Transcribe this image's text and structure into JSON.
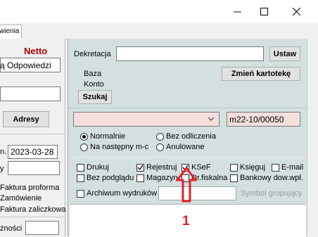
{
  "tab": {
    "label": "wienia"
  },
  "left": {
    "netto": "Netto",
    "odpowiedzi_value": "ą Odpowiedzi",
    "adresy": "Adresy",
    "date_label": "n.",
    "date_value": "2023-03-28",
    "y_label": "y",
    "options": [
      "Faktura proforma",
      "Zamówienie",
      "Faktura zaliczkowa"
    ],
    "znosci": "żności"
  },
  "right": {
    "dekretacja_label": "Dekretacja",
    "ustaw": "Ustaw",
    "baza_label": "Baza",
    "konto_label": "Konto",
    "zmien": "Zmień kartotekę",
    "szukaj": "Szukaj",
    "doc_number": "m22-10/00050",
    "radios": {
      "normalnie": "Normalnie",
      "bez_odliczenia": "Bez odliczenia",
      "na_nastepny": "Na następny m-c",
      "anulowane": "Anulowane"
    },
    "checks": {
      "drukuj": "Drukuj",
      "rejestruj": "Rejestruj",
      "ksef": "KSeF",
      "ksieguj": "Księguj",
      "email": "E-mail",
      "bez_podgladu": "Bez podglądu",
      "magazyn": "Magazyn",
      "dr_fiskalna": "Dr.fiskalna",
      "bankowy": "Bankowy dow.wpł.",
      "archiwum": "Archiwum wydruków",
      "symbol": "Symbol grupujący"
    },
    "checked": [
      "rejestruj",
      "ksef"
    ]
  },
  "annotation": {
    "number": "1",
    "color": "#e8202a"
  },
  "colors": {
    "netto": "#b00000",
    "panel": "#d4e0e0",
    "dropdown": "#f5dede"
  }
}
